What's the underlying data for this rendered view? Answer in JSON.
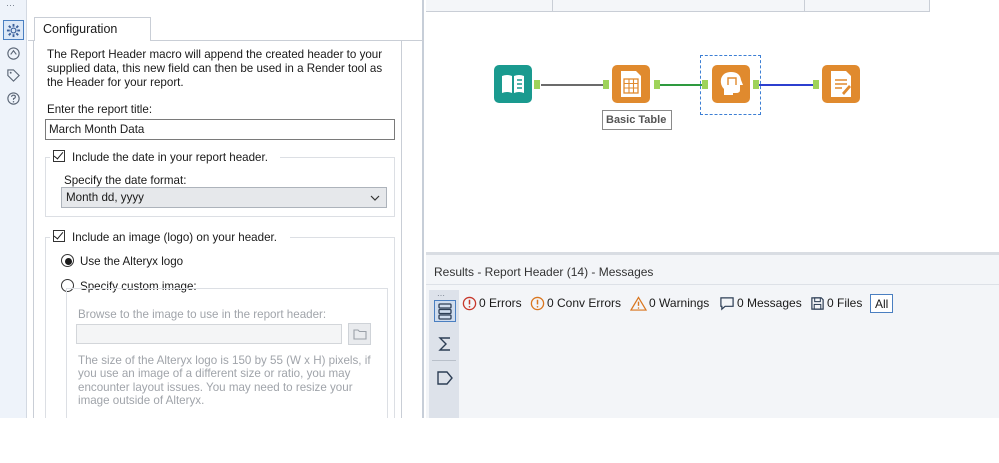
{
  "config": {
    "tab_label": "Configuration",
    "description": "The Report Header macro will append the created header to your supplied data, this new field can then be used in a Render tool as the Header for your report.",
    "title_label": "Enter the report title:",
    "title_value": "March Month Data",
    "include_date_label": "Include the date in your report header.",
    "include_date_checked": true,
    "date_format_label": "Specify the date format:",
    "date_format_value": "Month dd, yyyy",
    "include_image_label": "Include an image (logo) on your header.",
    "include_image_checked": true,
    "use_logo_label": "Use the Alteryx logo",
    "custom_image_label": "Specify custom image:",
    "selected_logo_option": "Use the Alteryx logo",
    "browse_label": "Browse to the image to use in the report header:",
    "size_note": "The size of the Alteryx logo is 150 by 55 (W x H) pixels, if you use an image of a different size or ratio, you may encounter layout issues. You may need to resize your image outside of Alteryx."
  },
  "canvas": {
    "tool_annotation": "Basic Table",
    "colors": {
      "input_tool": "#1a9a8f",
      "table_tool": "#e08a2e",
      "header_tool": "#e08a2e",
      "layout_tool": "#e08a2e",
      "wire_gray": "#6b6b6b",
      "wire_green": "#2e9a3f",
      "wire_blue": "#2c3fcf",
      "anchor_green": "#9fd35a"
    },
    "tools": [
      "input-data-icon",
      "basic-table-icon",
      "report-header-icon",
      "layout-icon"
    ]
  },
  "results": {
    "title": "Results - Report Header (14) - Messages",
    "errors": "0 Errors",
    "conv_errors": "0 Conv Errors",
    "warnings": "0 Warnings",
    "messages": "0 Messages",
    "files": "0 Files",
    "all": "All"
  }
}
